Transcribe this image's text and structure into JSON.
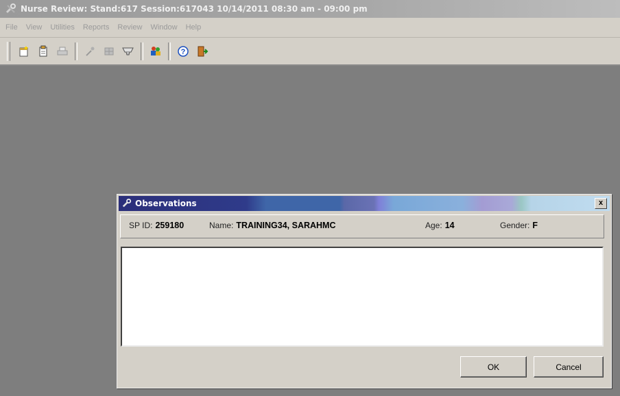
{
  "window": {
    "title": "Nurse Review: Stand:617 Session:617043 10/14/2011 08:30 am - 09:00 pm",
    "app_icon": "tools-icon"
  },
  "menu": [
    "File",
    "View",
    "Utilities",
    "Reports",
    "Review",
    "Window",
    "Help"
  ],
  "toolbar": {
    "buttons": [
      "new-document-icon",
      "clipboard-icon",
      "print-icon",
      "dropper-icon",
      "grid-icon",
      "scanner-icon",
      "people-icon",
      "help-icon",
      "exit-door-icon"
    ]
  },
  "dialog": {
    "title": "Observations",
    "close_label": "x",
    "sp_id_label": "SP ID:",
    "sp_id_value": "259180",
    "name_label": "Name:",
    "name_value": "TRAINING34, SARAHMC",
    "age_label": "Age:",
    "age_value": "14",
    "gender_label": "Gender:",
    "gender_value": "F",
    "observation_text": "",
    "ok_label": "OK",
    "cancel_label": "Cancel"
  },
  "colors": {
    "desktop": "#7e7e7e",
    "dialog_face": "#d4d0c8",
    "title_gradient_start": "#2b2f7a",
    "title_gradient_end": "#c0dcf0"
  }
}
